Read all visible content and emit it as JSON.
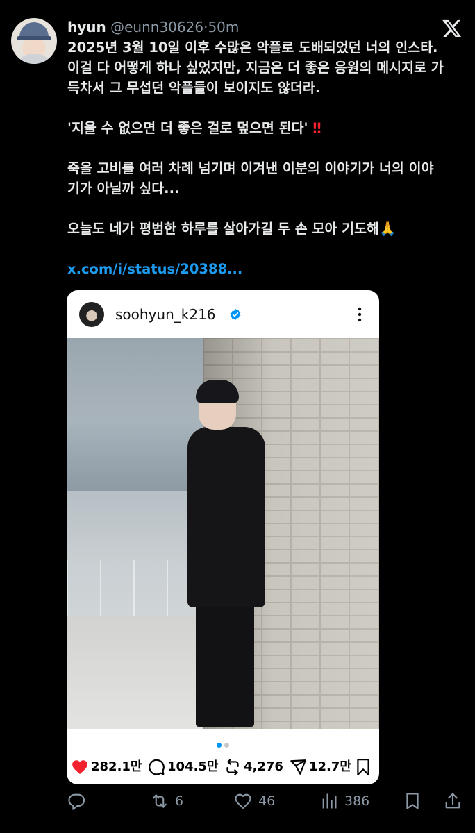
{
  "tweet": {
    "author_name": "hyun",
    "author_handle": "@eunn30626",
    "separator": "·",
    "time": "50m",
    "paragraphs": [
      "2025년 3월 10일 이후 수많은 악플로 도배되었던 너의 인스타.\n이걸 다 어떻게 하나 싶었지만, 지금은 더 좋은 응원의 메시지로 가\n득차서 그 무섭던 악플들이 보이지도 않더라.",
      "'지울 수 없으면 더 좋은 걸로 덮으면 된다'",
      "죽을 고비를 여러 차례 넘기며 이겨낸 이분의 이야기가 너의 이야\n기가 아닐까 싶다...",
      "오늘도 네가 평범한 하루를 살아가길 두 손 모아 기도해"
    ],
    "emoji_exclaim": "‼",
    "emoji_pray": "🙏",
    "link": "x.com/i/status/20388..."
  },
  "embedded_post": {
    "username": "soohyun_k216",
    "likes": "282.1만",
    "comments": "104.5만",
    "reposts": "4,276",
    "shares": "12.7만"
  },
  "actions": {
    "retweets": "6",
    "likes": "46",
    "views": "386"
  },
  "colors": {
    "background": "#000000",
    "text": "#e7e9ea",
    "muted": "#8b98a5",
    "link": "#1d9bf0",
    "heart": "#f4212e",
    "verified": "#0095f6"
  },
  "icons": [
    "x-logo-icon",
    "verified-badge-icon",
    "more-options-icon",
    "heart-filled-icon",
    "comment-icon",
    "repost-icon",
    "share-icon",
    "bookmark-icon",
    "reply-icon",
    "retweet-icon",
    "like-icon",
    "views-icon"
  ]
}
